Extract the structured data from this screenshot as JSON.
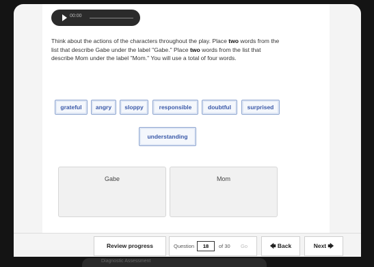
{
  "audio": {
    "time": "00:00"
  },
  "prompt": {
    "p1": "Think about the actions of the characters throughout the play. Place ",
    "b1": "two",
    "p2": " words from the list that describe Gabe under the label \"Gabe.\" Place ",
    "b2": "two",
    "p3": " words from the list that describe Mom under the label \"Mom.\" You will use a total of four words."
  },
  "words": [
    "grateful",
    "angry",
    "sloppy",
    "responsible",
    "doubtful",
    "surprised",
    "understanding"
  ],
  "drop_zones": {
    "gabe": "Gabe",
    "mom": "Mom"
  },
  "nav": {
    "review": "Review progress",
    "question_label": "Question",
    "question_value": "18",
    "of_total": "of 30",
    "go": "Go",
    "back": "Back",
    "next": "Next"
  },
  "lower_device": {
    "title": "Diagnostic Assessment"
  }
}
